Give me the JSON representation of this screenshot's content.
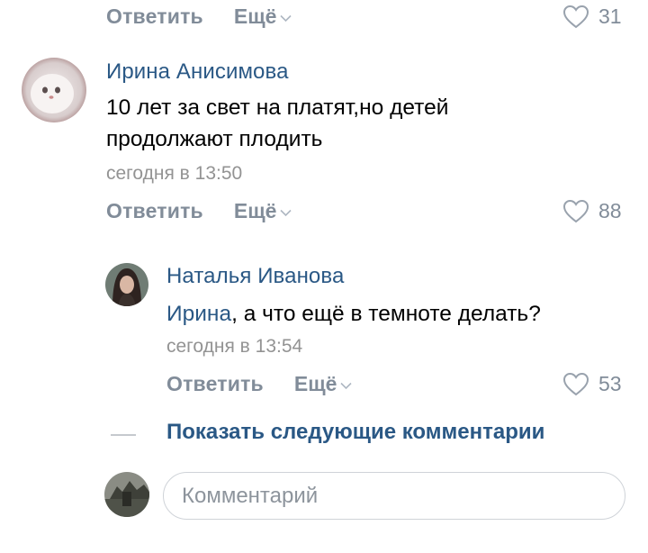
{
  "actions": {
    "reply_label": "Ответить",
    "more_label": "Ещё"
  },
  "top_row": {
    "likes": "31"
  },
  "comments": [
    {
      "author": "Ирина Анисимова",
      "text_line1": "10 лет за свет на платят,но детей",
      "text_line2": "продолжают плодить",
      "time": "сегодня в 13:50",
      "likes": "88"
    },
    {
      "author": "Наталья Иванова",
      "mention": "Ирина",
      "text_rest": ", а что ещё в темноте делать?",
      "time": "сегодня в 13:54",
      "likes": "53"
    }
  ],
  "show_more_label": "Показать следующие комментарии",
  "comment_input": {
    "placeholder": "Комментарий"
  },
  "colors": {
    "link": "#2a5885",
    "muted": "#818c99",
    "time": "#939393"
  },
  "icons": {
    "like": "heart-outline-icon",
    "more": "chevron-down-icon"
  }
}
